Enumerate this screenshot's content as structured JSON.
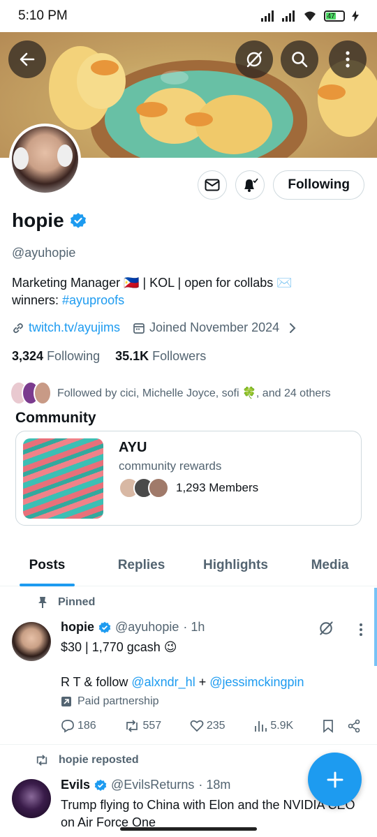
{
  "status_bar": {
    "time": "5:10 PM",
    "battery": "47"
  },
  "profile": {
    "name": "hopie",
    "handle": "@ayuhopie",
    "bio_line1": "Marketing Manager 🇵🇭 | KOL | open for collabs ✉️",
    "bio_line2_prefix": "winners: ",
    "bio_line2_hashtag": "#ayuproofs",
    "website": "twitch.tv/ayujims",
    "joined": "Joined November 2024",
    "following_count": "3,324",
    "following_label": "Following",
    "followers_count": "35.1K",
    "followers_label": "Followers",
    "followed_by": "Followed by cici, Michelle Joyce, sofi 🍀, and 24 others",
    "following_button": "Following"
  },
  "community": {
    "section_title": "Community",
    "name": "AYU",
    "subtitle": "community rewards",
    "members": "1,293 Members"
  },
  "tabs": [
    {
      "label": "Posts",
      "active": true
    },
    {
      "label": "Replies",
      "active": false
    },
    {
      "label": "Highlights",
      "active": false
    },
    {
      "label": "Media",
      "active": false
    }
  ],
  "pinned_post": {
    "pinned_label": "Pinned",
    "author": "hopie",
    "handle": "@ayuhopie",
    "time": "· 1h",
    "line1": "$30 | 1,770 gcash 😉",
    "line2_prefix": "R T & follow ",
    "mention1": "@alxndr_hl",
    "line2_mid": " + ",
    "mention2": "@jessimckingpin",
    "paid_label": "Paid partnership",
    "replies": "186",
    "reposts": "557",
    "likes": "235",
    "views": "5.9K"
  },
  "second_post": {
    "repost_label": "hopie reposted",
    "author": "Evils",
    "handle": "@EvilsReturns",
    "time": "· 18m",
    "text": "Trump flying to China with Elon and the NVIDIA CEO on Air Force One"
  },
  "colors": {
    "accent": "#1d9bf0",
    "text": "#0f1419",
    "muted": "#536471",
    "border": "#cfd9de"
  }
}
